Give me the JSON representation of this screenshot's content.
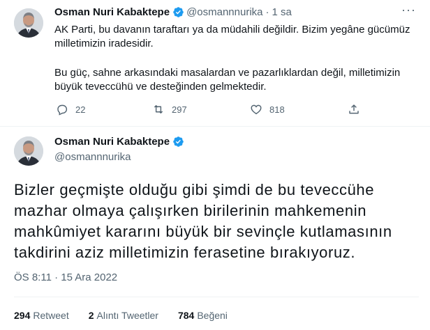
{
  "reply_tweet": {
    "author_name": "Osman Nuri Kabaktepe",
    "handle": "@osmannnurika",
    "separator": "·",
    "time": "1 sa",
    "more_icon": "more-dots-icon",
    "paragraph1": "AK Parti, bu davanın taraftarı ya da müdahili değildir. Bizim yegâne gücümüz milletimizin iradesidir.",
    "paragraph2": "Bu güç, sahne arkasındaki masalardan ve pazarlıklardan değil, milletimizin büyük teveccühü ve desteğinden gelmektedir.",
    "actions": {
      "reply_count": "22",
      "retweet_count": "297",
      "like_count": "818"
    }
  },
  "main_tweet": {
    "author_name": "Osman Nuri Kabaktepe",
    "handle": "@osmannnurika",
    "text": "Bizler geçmişte olduğu gibi şimdi de bu teveccühe mazhar olmaya çalışırken birilerinin mahkemenin mahkûmiyet kararını büyük bir sevinçle kutlamasının takdirini aziz milletimizin ferasetine bırakıyoruz.",
    "timestamp": "ÖS 8:11 · 15 Ara 2022",
    "stats": {
      "retweets_count": "294",
      "retweets_label": "Retweet",
      "quotes_count": "2",
      "quotes_label": "Alıntı Tweetler",
      "likes_count": "784",
      "likes_label": "Beğeni"
    }
  },
  "colors": {
    "verified_blue": "#1d9bf0",
    "secondary_text": "#536471",
    "divider": "#eff3f4"
  }
}
